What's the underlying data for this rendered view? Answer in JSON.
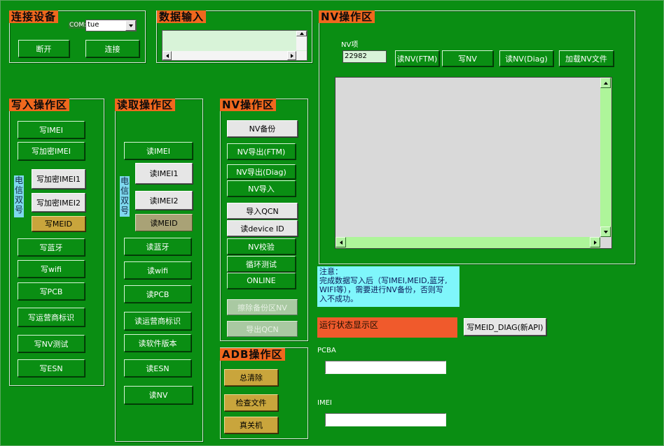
{
  "connect": {
    "title": "连接设备",
    "com_label": "COM:",
    "com_value": "tue",
    "disconnect": "断开",
    "connect": "连接"
  },
  "data_input": {
    "title": "数据输入",
    "value": ""
  },
  "nv_area": {
    "title": "NV操作区",
    "nv_item_label": "NV项",
    "nv_item_value": "22982",
    "buttons": [
      "读NV(FTM)",
      "写NV",
      "读NV(Diag)",
      "加载NV文件"
    ]
  },
  "write_area": {
    "title": "写入操作区",
    "side_label": "电信双号",
    "buttons": [
      "写IMEI",
      "写加密IMEI",
      "写加密IMEI1",
      "写加密IMEI2",
      "写MEID",
      "写蓝牙",
      "写wifi",
      "写PCB",
      "写运营商标识",
      "写NV测试",
      "写ESN"
    ]
  },
  "read_area": {
    "title": "读取操作区",
    "side_label": "电信双号",
    "buttons": [
      "读IMEI",
      "读IMEI1",
      "读IMEI2",
      "读MEID",
      "读蓝牙",
      "读wifi",
      "读PCB",
      "读运营商标识",
      "读软件版本",
      "读ESN",
      "读NV"
    ]
  },
  "nv_ops": {
    "title": "NV操作区",
    "buttons": [
      "NV备份",
      "NV导出(FTM)",
      "NV导出(Diag)",
      "NV导入",
      "导入QCN",
      "读device ID",
      "NV校验",
      "循环测试",
      "ONLINE",
      "擦除备份区NV",
      "导出QCN"
    ]
  },
  "adb": {
    "title": "ADB操作区",
    "buttons": [
      "总清除",
      "检查文件",
      "真关机"
    ]
  },
  "note": {
    "lines": [
      "注意：",
      "完成数据写入后（写IMEI,MEID,蓝牙,",
      "WIFI等），需要进行NV备份，否则写",
      "入不成功。"
    ]
  },
  "status": {
    "label": "运行状态显示区"
  },
  "meid_diag_button": "写MEID_DIAG(新API)",
  "pcba": {
    "label": "PCBA",
    "value": ""
  },
  "imei": {
    "label": "IMEI",
    "value": ""
  },
  "colors": {
    "background": "#0a8e13",
    "title_bg": "#f0681e",
    "note_bg": "#7ff6fb",
    "status_bg": "#f05a2c",
    "gold_button": "#c9a53c"
  }
}
